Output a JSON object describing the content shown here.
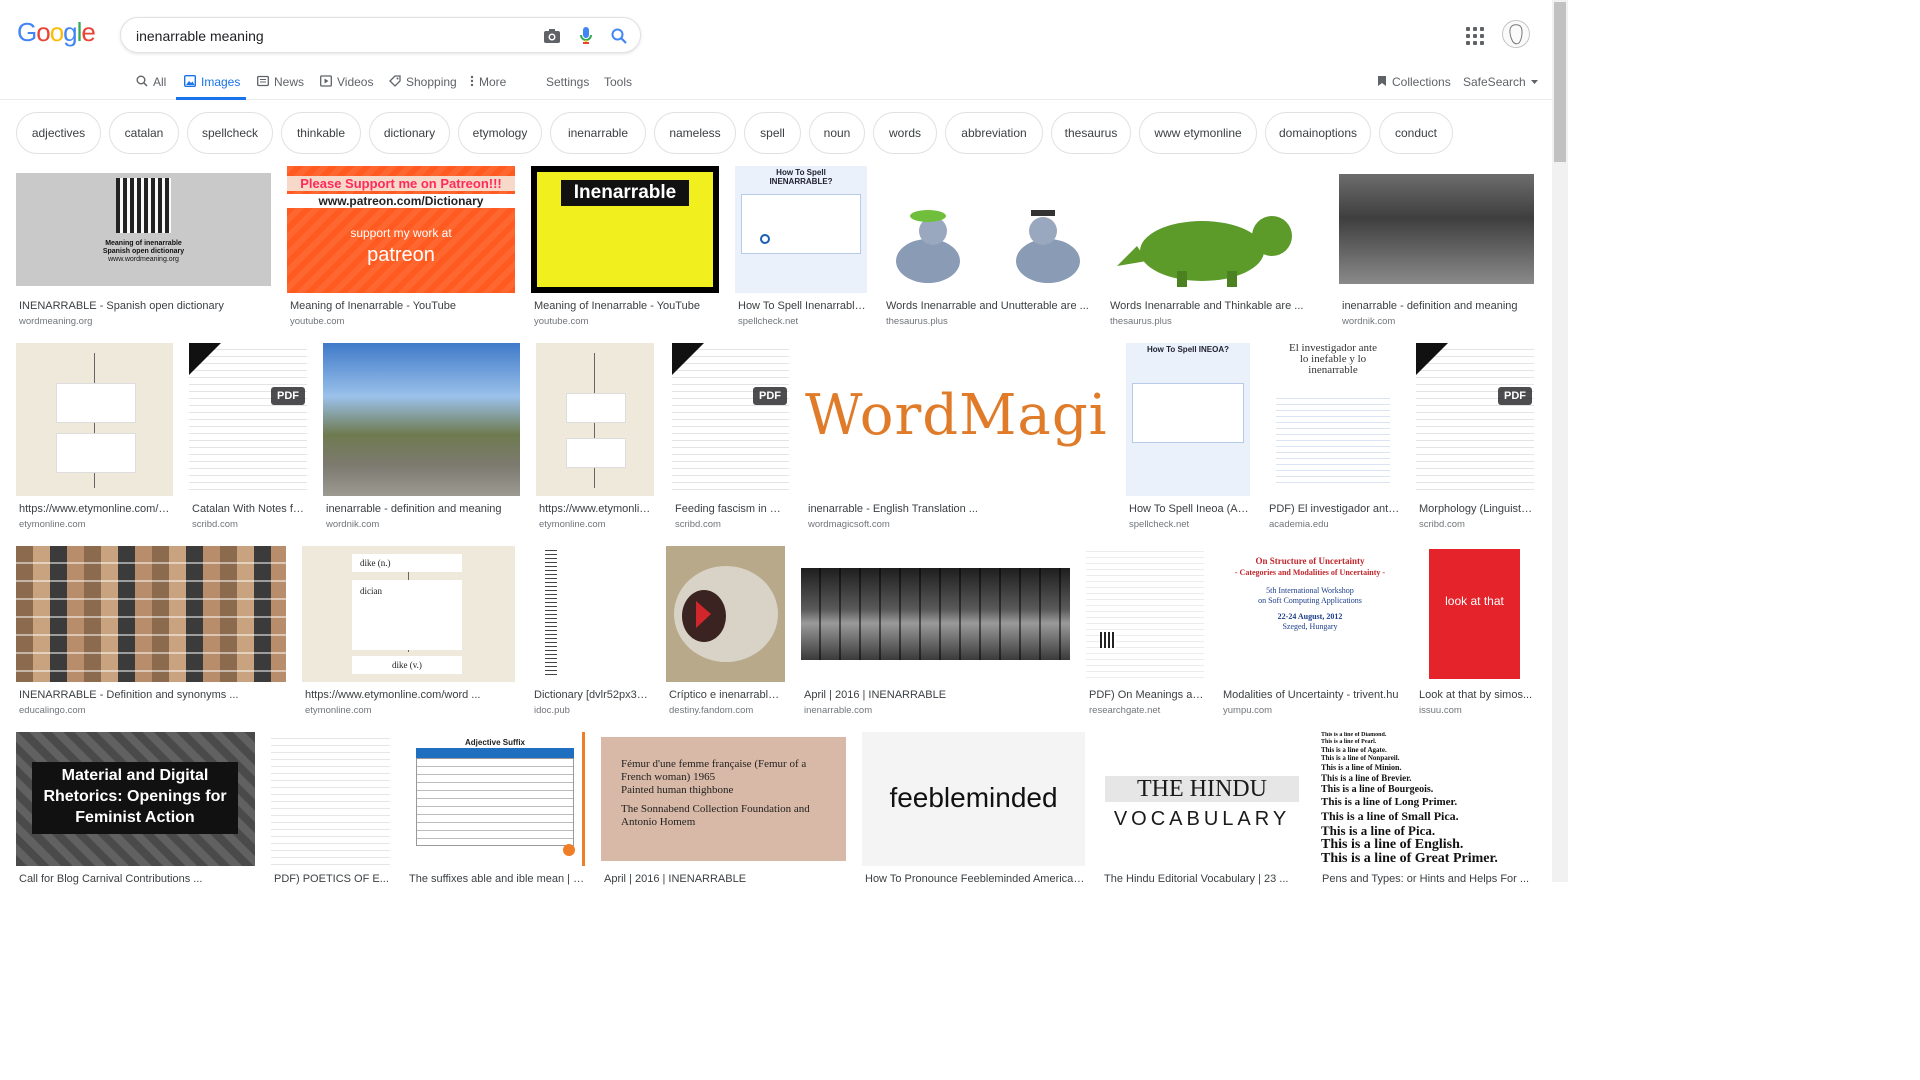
{
  "search": {
    "query": "inenarrable meaning"
  },
  "logo": [
    "G",
    "o",
    "o",
    "g",
    "l",
    "e"
  ],
  "tabs": {
    "all": "All",
    "images": "Images",
    "news": "News",
    "videos": "Videos",
    "shopping": "Shopping",
    "more": "More",
    "settings": "Settings",
    "tools": "Tools",
    "collections": "Collections",
    "safesearch": "SafeSearch"
  },
  "chips": [
    "adjectives",
    "catalan",
    "spellcheck",
    "thinkable",
    "dictionary",
    "etymology",
    "inenarrable",
    "nameless",
    "spell",
    "noun",
    "words",
    "abbreviation",
    "thesaurus",
    "www etymonline",
    "domainoptions",
    "conduct"
  ],
  "results": [
    {
      "caption": "INENARRABLE - Spanish open dictionary",
      "source": "wordmeaning.org",
      "img_text": [
        "Meaning of inenarrable",
        "Spanish open dictionary",
        "www.wordmeaning.org"
      ]
    },
    {
      "caption": "Meaning of Inenarrable - YouTube",
      "source": "youtube.com",
      "img_text": [
        "Please Support me on Patreon!!!",
        "www.patreon.com/Dictionary",
        "support my work at",
        "patreon"
      ]
    },
    {
      "caption": "Meaning of Inenarrable - YouTube",
      "source": "youtube.com",
      "img_text": [
        "Inenarrable"
      ]
    },
    {
      "caption": "How To Spell Inenarrable...",
      "source": "spellcheck.net",
      "img_text": [
        "How To Spell INENARRABLE?"
      ]
    },
    {
      "caption": "Words Inenarrable and Unutterable are ...",
      "source": "thesaurus.plus"
    },
    {
      "caption": "Words Inenarrable and Thinkable are ...",
      "source": "thesaurus.plus"
    },
    {
      "caption": "inenarrable - definition and meaning",
      "source": "wordnik.com"
    },
    {
      "caption": "https://www.etymonline.com/w...",
      "source": "etymonline.com"
    },
    {
      "caption": "Catalan With Notes fo...",
      "source": "scribd.com"
    },
    {
      "caption": "inenarrable - definition and meaning",
      "source": "wordnik.com"
    },
    {
      "caption": "https://www.etymonlin...",
      "source": "etymonline.com"
    },
    {
      "caption": "Feeding fascism in Gr...",
      "source": "scribd.com"
    },
    {
      "caption": "inenarrable - English Translation ...",
      "source": "wordmagicsoft.com",
      "img_text": [
        "WordMagic"
      ]
    },
    {
      "caption": "How To Spell Ineoa (An...",
      "source": "spellcheck.net",
      "img_text": [
        "How To Spell INEOA?"
      ]
    },
    {
      "caption": "PDF) El investigador ante...",
      "source": "academia.edu",
      "img_text": [
        "El investigador ante lo inefable y lo inenarrable"
      ]
    },
    {
      "caption": "Morphology (Linguistic...",
      "source": "scribd.com"
    },
    {
      "caption": "INENARRABLE - Definition and synonyms ...",
      "source": "educalingo.com"
    },
    {
      "caption": "https://www.etymonline.com/word ...",
      "source": "etymonline.com",
      "img_text": [
        "dike (n.)",
        "dician",
        "dike (v.)"
      ]
    },
    {
      "caption": "Dictionary [dvlr52px3v...",
      "source": "idoc.pub"
    },
    {
      "caption": "Críptico e inenarrable\"...",
      "source": "destiny.fandom.com"
    },
    {
      "caption": "April | 2016 | INENARRABLE",
      "source": "inenarrable.com"
    },
    {
      "caption": "PDF) On Meanings an...",
      "source": "researchgate.net"
    },
    {
      "caption": "Modalities of Uncertainty - trivent.hu",
      "source": "yumpu.com",
      "img_text": [
        "On Structure of Uncertainty",
        "- Categories and Modalities of Uncertainty -",
        "5th International Workshop",
        "on Soft Computing Applications",
        "22-24 August, 2012",
        "Szeged, Hungary"
      ]
    },
    {
      "caption": "Look at that by simos...",
      "source": "issuu.com",
      "img_text": [
        "look at that"
      ]
    },
    {
      "caption": "Call for Blog Carnival Contributions ...",
      "source": "",
      "img_text": [
        "Material and Digital Rhetorics: Openings for Feminist Action"
      ]
    },
    {
      "caption": "PDF) POETICS OF E...",
      "source": ""
    },
    {
      "caption": "The suffixes able and ible mean | Blog ...",
      "source": "",
      "img_text": [
        "Adjective Suffix"
      ]
    },
    {
      "caption": "April | 2016 | INENARRABLE",
      "source": "",
      "img_text": [
        "Fémur d'une femme française (Femur of a French woman) 1965",
        "Painted human thighbone",
        "The Sonnabend Collection Foundation and Antonio Homem"
      ]
    },
    {
      "caption": "How To Pronounce Feebleminded American ...",
      "source": "",
      "img_text": [
        "feebleminded"
      ]
    },
    {
      "caption": "The Hindu Editorial Vocabulary | 23 ...",
      "source": "",
      "img_text": [
        "THE HINDU",
        "VOCABULARY"
      ]
    },
    {
      "caption": "Pens and Types: or Hints and Helps For ...",
      "source": "",
      "img_text": [
        "This is a line of Diamond.",
        "This is a line of Pearl.",
        "This is a line of Agate.",
        "This is a line of Nonpareil.",
        "This is a line of Minion.",
        "This is a line of Brevier.",
        "This is a line of Bourgeois.",
        "This is a line of Long Primer.",
        "This is a line of Small Pica.",
        "This is a line of Pica.",
        "This is a line of English.",
        "This is a line of Great Primer."
      ]
    }
  ],
  "pdf_badge": "PDF",
  "colors": {
    "accent": "#1a73e8",
    "chip_border": "#dfe1e5",
    "source_gray": "#70757a"
  }
}
